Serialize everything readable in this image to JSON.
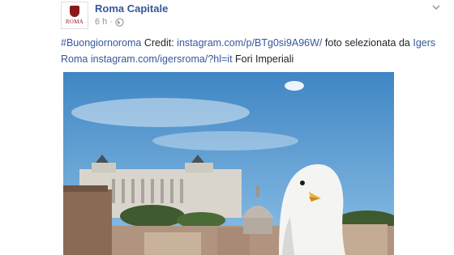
{
  "post": {
    "page_name": "Roma Capitale",
    "avatar_text": "ROMA",
    "timestamp": "6 h",
    "separator": "·",
    "text": {
      "hashtag": "#Buongiornoroma",
      "credit_label": "Credit:",
      "credit_link": "instagram.com/p/BTg0si9A96W/",
      "phrase_1": "foto selezionata da",
      "igers_link": "Igers Roma",
      "profile_link": "instagram.com/igersroma/?hl=it",
      "location": "Fori Imperiali"
    },
    "photo": {
      "icons": {
        "avatar": "roma-crest-icon",
        "privacy": "globe-icon",
        "menu": "chevron-down-icon"
      }
    }
  },
  "colors": {
    "link": "#365899",
    "text": "#1d2129",
    "meta": "#90949c",
    "sky": "#4a90c8"
  }
}
